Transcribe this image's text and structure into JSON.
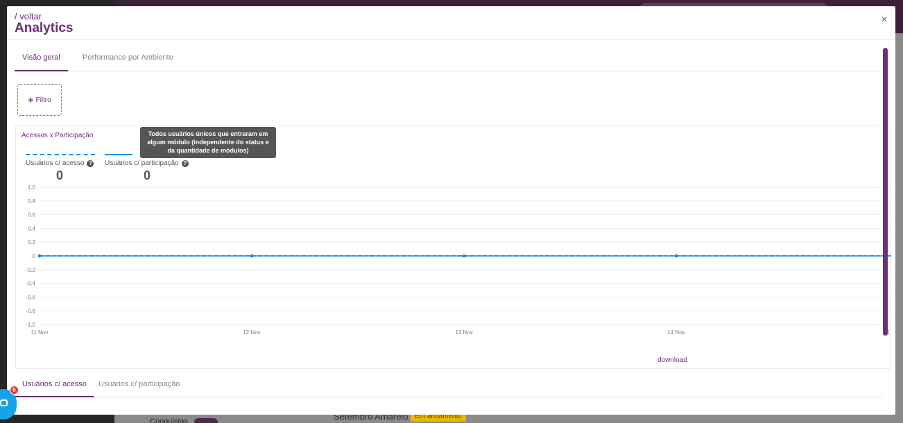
{
  "background": {
    "conquistas_label": "Conquistas",
    "course_title": "Setembro Amarelo",
    "status_badge": "Em andamento"
  },
  "modal": {
    "back_link": "/ voltar",
    "title": "Analytics",
    "close_icon": "×",
    "tabs": [
      {
        "label": "Visão geral",
        "active": true
      },
      {
        "label": "Performance por Ambiente",
        "active": false
      }
    ],
    "filter_label": "Filtro",
    "filter_icon": "+",
    "bottom_tabs": [
      {
        "label": "Usuários c/ acesso",
        "active": true
      },
      {
        "label": "Usuários c/ participação",
        "active": false
      }
    ],
    "download_label": "download"
  },
  "chart_legend": {
    "access_label": "Usuários c/ acesso",
    "access_value": "0",
    "participation_label": "Usuários c/ participação",
    "participation_value": "0",
    "help_icon": "?"
  },
  "tooltip": {
    "text": "Todos usuários únicos que entraram em algum módulo (independente do status e da quantidade de módulos)"
  },
  "chat": {
    "badge_count": "6"
  },
  "colors": {
    "brand": "#6d2f7a",
    "series": "#1e90e6",
    "chat": "#16a4e6",
    "badge": "#e23b2b"
  },
  "chart_data": {
    "type": "line",
    "title": "Acessos x Participação",
    "x": [
      "11 Nov",
      "12 Nov",
      "13 Nov",
      "14 Nov",
      "1"
    ],
    "yticks": [
      "1.0",
      "0.8",
      "0.6",
      "0.4",
      "0.2",
      "0",
      "-0.2",
      "-0.4",
      "-0.6",
      "-0.8",
      "-1.0"
    ],
    "ylim": [
      -1,
      1
    ],
    "grid": true,
    "series": [
      {
        "name": "Usuários c/ acesso",
        "style": "dashed",
        "values": [
          0,
          0,
          0,
          0,
          0
        ]
      },
      {
        "name": "Usuários c/ participação",
        "style": "solid",
        "values": [
          0,
          0,
          0,
          0,
          0
        ]
      }
    ]
  }
}
